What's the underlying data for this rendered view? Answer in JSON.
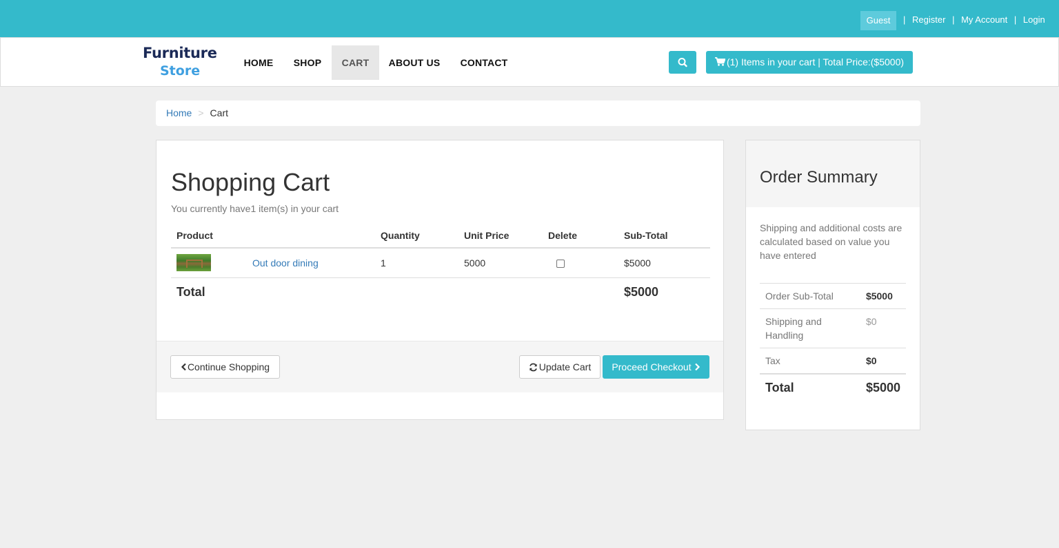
{
  "topbar": {
    "guest": "Guest",
    "links": [
      "Register",
      "My Account",
      "Login"
    ],
    "separator": "|"
  },
  "brand": {
    "line1": "Furniture",
    "line2": "Store"
  },
  "nav": [
    "HOME",
    "SHOP",
    "CART",
    "ABOUT US",
    "CONTACT"
  ],
  "nav_active": "CART",
  "cart_button": "(1) Items in your cart | Total Price:($5000)",
  "icons": {
    "search": "search-icon",
    "cart": "shopping-cart-icon",
    "update": "refresh-icon",
    "back": "chevron-left-icon",
    "forward": "chevron-right-icon"
  },
  "breadcrumb": {
    "home": "Home",
    "divider": ">",
    "current": "Cart"
  },
  "cart": {
    "title": "Shopping Cart",
    "subtitle": "You currently have1 item(s) in your cart",
    "headers": [
      "Product",
      "Quantity",
      "Unit Price",
      "Delete",
      "Sub-Total"
    ],
    "items": [
      {
        "name": "Out door dining",
        "quantity": "1",
        "unit_price": "5000",
        "delete_checked": false,
        "subtotal": "$5000"
      }
    ],
    "total_label": "Total",
    "total_value": "$5000",
    "continue": "Continue Shopping",
    "update": "Update Cart",
    "checkout": "Proceed Checkout"
  },
  "summary": {
    "title": "Order Summary",
    "note": "Shipping and additional costs are calculated based on value you have entered",
    "rows": [
      {
        "label": "Order Sub-Total",
        "value": "$5000"
      },
      {
        "label": "Shipping and Handling",
        "value": "$0"
      },
      {
        "label": "Tax",
        "value": "$0"
      }
    ],
    "total_label": "Total",
    "total_value": "$5000"
  },
  "colors": {
    "accent": "#34bacb",
    "link": "#337ab7",
    "brand_dark": "#1b2a57",
    "brand_light": "#3e9fe0"
  }
}
